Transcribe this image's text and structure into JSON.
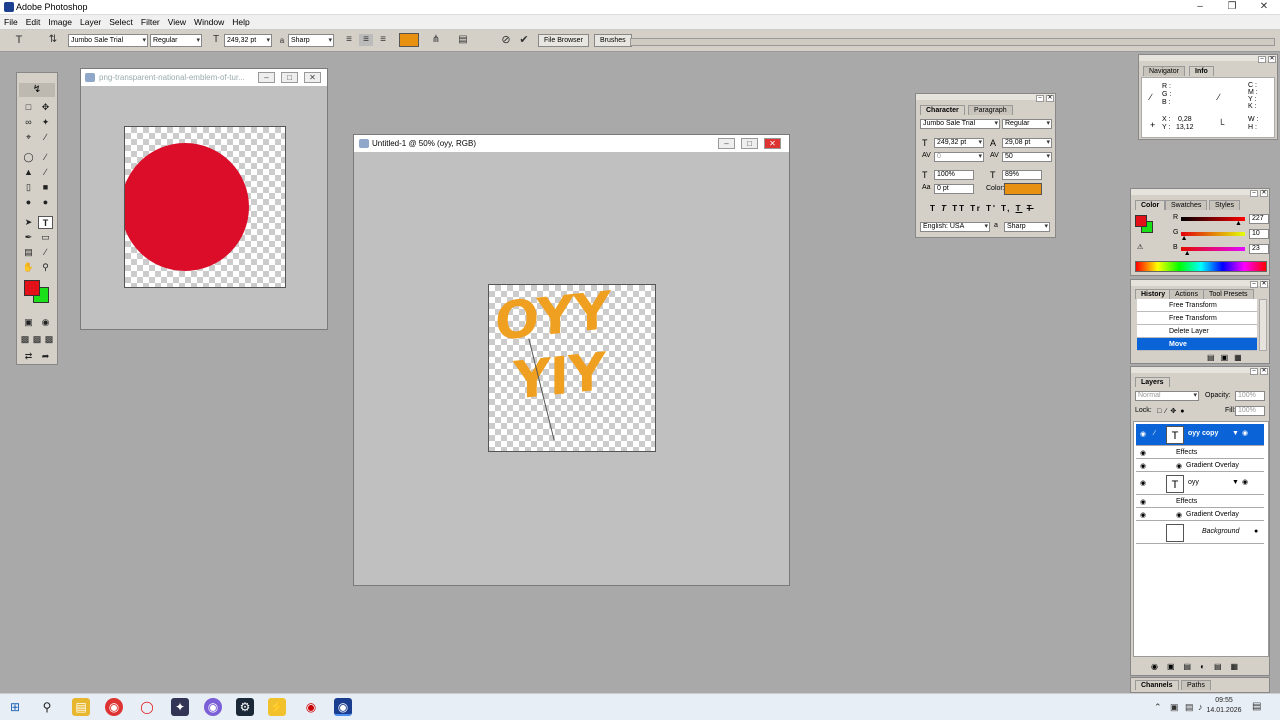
{
  "app": {
    "title": "Adobe Photoshop"
  },
  "menu": [
    "File",
    "Edit",
    "Image",
    "Layer",
    "Select",
    "Filter",
    "View",
    "Window",
    "Help"
  ],
  "options": {
    "font_family": "Jumbo Sale Trial",
    "font_style": "Regular",
    "font_size": "249,32 pt",
    "aa_label": "a",
    "antialias": "Sharp",
    "text_color": "#e89010",
    "tabs": [
      "File Browser",
      "Brushes"
    ]
  },
  "doc1": {
    "title": "png-transparent-national-emblem-of-tur..."
  },
  "doc2": {
    "title": "Untitled-1 @ 50% (oyy, RGB)",
    "text_line1": "OYY",
    "text_line2": "YIY"
  },
  "character": {
    "tabs": [
      "Character",
      "Paragraph"
    ],
    "font_family": "Jumbo Sale Trial",
    "font_style": "Regular",
    "size": "249,32 pt",
    "leading": "29,08 pt",
    "kerning": "0",
    "tracking": "50",
    "vscale": "100%",
    "hscale": "89%",
    "baseline": "0 pt",
    "color_label": "Color:",
    "color": "#e89010",
    "styles": [
      "T",
      "T",
      "TT",
      "Tr",
      "T'",
      "T,",
      "T",
      "T"
    ],
    "language": "English: USA",
    "aa_label": "a",
    "antialias": "Sharp"
  },
  "navinfo": {
    "tabs": [
      "Navigator",
      "Info"
    ],
    "rgb": [
      "R :",
      "G :",
      "B :"
    ],
    "cmyk": [
      "C :",
      "M :",
      "Y :",
      "K :"
    ],
    "x_label": "X :",
    "x": "0,28",
    "y_label": "Y :",
    "y": "13,12",
    "w_label": "W :",
    "h_label": "H :"
  },
  "color": {
    "tabs": [
      "Color",
      "Swatches",
      "Styles"
    ],
    "r_label": "R",
    "g_label": "G",
    "b_label": "B",
    "r": "227",
    "g": "10",
    "b": "23",
    "r_frac": 0.89,
    "g_frac": 0.04,
    "b_frac": 0.09
  },
  "history": {
    "tabs": [
      "History",
      "Actions",
      "Tool Presets"
    ],
    "items": [
      "Free Transform",
      "Free Transform",
      "Delete Layer",
      "Move"
    ]
  },
  "layers": {
    "title": "Layers",
    "mode": "Normal",
    "opacity_label": "Opacity:",
    "opacity": "100%",
    "lock_label": "Lock:",
    "fill_label": "Fill:",
    "fill": "100%",
    "rows": [
      {
        "name": "oyy copy",
        "effects": "Effects",
        "fx": "Gradient Overlay"
      },
      {
        "name": "oyy",
        "effects": "Effects",
        "fx": "Gradient Overlay"
      }
    ],
    "background": "Background"
  },
  "channels": {
    "tabs": [
      "Channels",
      "Paths"
    ]
  },
  "taskbar": {
    "time": "09:55",
    "date": "14.01.2026"
  }
}
